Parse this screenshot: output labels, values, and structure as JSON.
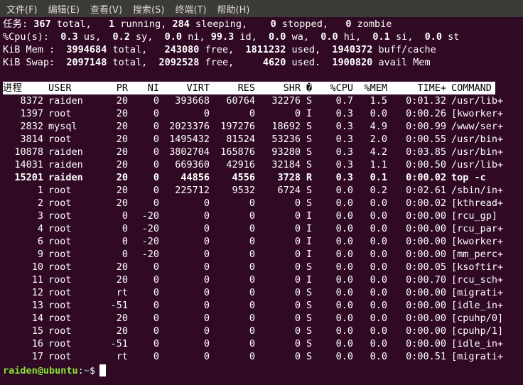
{
  "menu": {
    "items": [
      "文件(F)",
      "编辑(E)",
      "查看(V)",
      "搜索(S)",
      "终端(T)",
      "帮助(H)"
    ]
  },
  "summary": {
    "tasks": {
      "label": "任务:",
      "total": "367",
      "total_label": "total,",
      "running": "1",
      "running_label": "running,",
      "sleeping": "284",
      "sleeping_label": "sleeping,",
      "stopped": "0",
      "stopped_label": "stopped,",
      "zombie": "0",
      "zombie_label": "zombie"
    },
    "cpu": {
      "label": "%Cpu(s):",
      "us": "0.3",
      "us_label": "us,",
      "sy": "0.2",
      "sy_label": "sy,",
      "ni": "0.0",
      "ni_label": "ni,",
      "id": "99.3",
      "id_label": "id,",
      "wa": "0.0",
      "wa_label": "wa,",
      "hi": "0.0",
      "hi_label": "hi,",
      "si": "0.1",
      "si_label": "si,",
      "st": "0.0",
      "st_label": "st"
    },
    "mem": {
      "label": "KiB Mem :",
      "total": "3994684",
      "total_label": "total,",
      "free": "243080",
      "free_label": "free,",
      "used": "1811232",
      "used_label": "used,",
      "buff": "1940372",
      "buff_label": "buff/cache"
    },
    "swap": {
      "label": "KiB Swap:",
      "total": "2097148",
      "total_label": "total,",
      "free": "2092528",
      "free_label": "free,",
      "used": "4620",
      "used_label": "used.",
      "avail": "1900820",
      "avail_label": "avail Mem"
    }
  },
  "table": {
    "headers": [
      "进程",
      "USER",
      "PR",
      "NI",
      "VIRT",
      "RES",
      "SHR",
      "�",
      "%CPU",
      "%MEM",
      "TIME+",
      "COMMAND"
    ],
    "rows": [
      {
        "pid": "8372",
        "user": "raiden",
        "pr": "20",
        "ni": "0",
        "virt": "393668",
        "res": "60764",
        "shr": "32276",
        "s": "S",
        "cpu": "0.7",
        "mem": "1.5",
        "time": "0:01.32",
        "cmd": "/usr/lib+"
      },
      {
        "pid": "1397",
        "user": "root",
        "pr": "20",
        "ni": "0",
        "virt": "0",
        "res": "0",
        "shr": "0",
        "s": "I",
        "cpu": "0.3",
        "mem": "0.0",
        "time": "0:00.26",
        "cmd": "[kworker+"
      },
      {
        "pid": "2832",
        "user": "mysql",
        "pr": "20",
        "ni": "0",
        "virt": "2023376",
        "res": "197276",
        "shr": "18692",
        "s": "S",
        "cpu": "0.3",
        "mem": "4.9",
        "time": "0:00.99",
        "cmd": "/www/ser+"
      },
      {
        "pid": "3814",
        "user": "root",
        "pr": "20",
        "ni": "0",
        "virt": "1495432",
        "res": "81524",
        "shr": "53236",
        "s": "S",
        "cpu": "0.3",
        "mem": "2.0",
        "time": "0:00.55",
        "cmd": "/usr/bin+"
      },
      {
        "pid": "10878",
        "user": "raiden",
        "pr": "20",
        "ni": "0",
        "virt": "3802704",
        "res": "165876",
        "shr": "93280",
        "s": "S",
        "cpu": "0.3",
        "mem": "4.2",
        "time": "0:03.85",
        "cmd": "/usr/bin+"
      },
      {
        "pid": "14031",
        "user": "raiden",
        "pr": "20",
        "ni": "0",
        "virt": "669360",
        "res": "42916",
        "shr": "32184",
        "s": "S",
        "cpu": "0.3",
        "mem": "1.1",
        "time": "0:00.50",
        "cmd": "/usr/lib+"
      },
      {
        "pid": "15201",
        "user": "raiden",
        "pr": "20",
        "ni": "0",
        "virt": "44856",
        "res": "4556",
        "shr": "3728",
        "s": "R",
        "cpu": "0.3",
        "mem": "0.1",
        "time": "0:00.02",
        "cmd": "top -c",
        "bold": true
      },
      {
        "pid": "1",
        "user": "root",
        "pr": "20",
        "ni": "0",
        "virt": "225712",
        "res": "9532",
        "shr": "6724",
        "s": "S",
        "cpu": "0.0",
        "mem": "0.2",
        "time": "0:02.61",
        "cmd": "/sbin/in+"
      },
      {
        "pid": "2",
        "user": "root",
        "pr": "20",
        "ni": "0",
        "virt": "0",
        "res": "0",
        "shr": "0",
        "s": "S",
        "cpu": "0.0",
        "mem": "0.0",
        "time": "0:00.02",
        "cmd": "[kthread+"
      },
      {
        "pid": "3",
        "user": "root",
        "pr": "0",
        "ni": "-20",
        "virt": "0",
        "res": "0",
        "shr": "0",
        "s": "I",
        "cpu": "0.0",
        "mem": "0.0",
        "time": "0:00.00",
        "cmd": "[rcu_gp]"
      },
      {
        "pid": "4",
        "user": "root",
        "pr": "0",
        "ni": "-20",
        "virt": "0",
        "res": "0",
        "shr": "0",
        "s": "I",
        "cpu": "0.0",
        "mem": "0.0",
        "time": "0:00.00",
        "cmd": "[rcu_par+"
      },
      {
        "pid": "6",
        "user": "root",
        "pr": "0",
        "ni": "-20",
        "virt": "0",
        "res": "0",
        "shr": "0",
        "s": "I",
        "cpu": "0.0",
        "mem": "0.0",
        "time": "0:00.00",
        "cmd": "[kworker+"
      },
      {
        "pid": "9",
        "user": "root",
        "pr": "0",
        "ni": "-20",
        "virt": "0",
        "res": "0",
        "shr": "0",
        "s": "I",
        "cpu": "0.0",
        "mem": "0.0",
        "time": "0:00.00",
        "cmd": "[mm_perc+"
      },
      {
        "pid": "10",
        "user": "root",
        "pr": "20",
        "ni": "0",
        "virt": "0",
        "res": "0",
        "shr": "0",
        "s": "S",
        "cpu": "0.0",
        "mem": "0.0",
        "time": "0:00.05",
        "cmd": "[ksoftir+"
      },
      {
        "pid": "11",
        "user": "root",
        "pr": "20",
        "ni": "0",
        "virt": "0",
        "res": "0",
        "shr": "0",
        "s": "I",
        "cpu": "0.0",
        "mem": "0.0",
        "time": "0:00.70",
        "cmd": "[rcu_sch+"
      },
      {
        "pid": "12",
        "user": "root",
        "pr": "rt",
        "ni": "0",
        "virt": "0",
        "res": "0",
        "shr": "0",
        "s": "S",
        "cpu": "0.0",
        "mem": "0.0",
        "time": "0:00.00",
        "cmd": "[migrati+"
      },
      {
        "pid": "13",
        "user": "root",
        "pr": "-51",
        "ni": "0",
        "virt": "0",
        "res": "0",
        "shr": "0",
        "s": "S",
        "cpu": "0.0",
        "mem": "0.0",
        "time": "0:00.00",
        "cmd": "[idle_in+"
      },
      {
        "pid": "14",
        "user": "root",
        "pr": "20",
        "ni": "0",
        "virt": "0",
        "res": "0",
        "shr": "0",
        "s": "S",
        "cpu": "0.0",
        "mem": "0.0",
        "time": "0:00.00",
        "cmd": "[cpuhp/0]"
      },
      {
        "pid": "15",
        "user": "root",
        "pr": "20",
        "ni": "0",
        "virt": "0",
        "res": "0",
        "shr": "0",
        "s": "S",
        "cpu": "0.0",
        "mem": "0.0",
        "time": "0:00.00",
        "cmd": "[cpuhp/1]"
      },
      {
        "pid": "16",
        "user": "root",
        "pr": "-51",
        "ni": "0",
        "virt": "0",
        "res": "0",
        "shr": "0",
        "s": "S",
        "cpu": "0.0",
        "mem": "0.0",
        "time": "0:00.00",
        "cmd": "[idle_in+"
      },
      {
        "pid": "17",
        "user": "root",
        "pr": "rt",
        "ni": "0",
        "virt": "0",
        "res": "0",
        "shr": "0",
        "s": "S",
        "cpu": "0.0",
        "mem": "0.0",
        "time": "0:00.51",
        "cmd": "[migrati+"
      }
    ]
  },
  "prompt": {
    "user_host": "raiden@ubuntu",
    "sep": ":",
    "path": "~",
    "symbol": "$"
  },
  "colors": {
    "terminal_bg": "#300a24",
    "menubar_bg": "#3c3b37",
    "prompt_user": "#8ae234",
    "prompt_path": "#729fcf"
  }
}
